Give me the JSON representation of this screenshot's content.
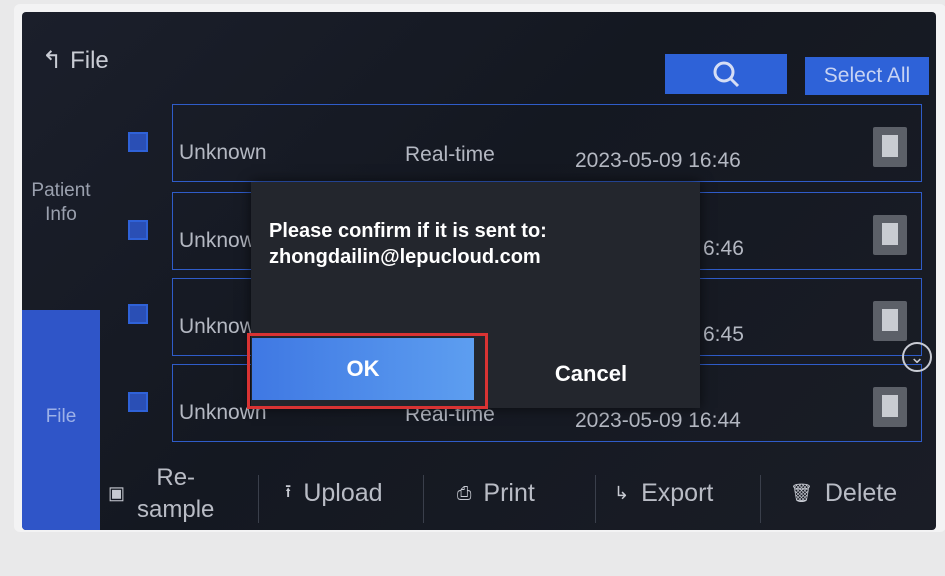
{
  "header": {
    "back_icon": "back-arrow-icon",
    "title": "File",
    "search_icon": "search-icon",
    "select_all": "Select All"
  },
  "sidebar": {
    "items": [
      {
        "label": "Patient\nInfo"
      },
      {
        "label": "File"
      }
    ]
  },
  "records": [
    {
      "name": "Unknown",
      "mode": "Real-time",
      "time": "2023-05-09 16:46"
    },
    {
      "name": "Unknow",
      "mode": "",
      "time": "6:46"
    },
    {
      "name": "Unknow",
      "mode": "",
      "time": "6:45"
    },
    {
      "name": "Unknown",
      "mode": "Real-time",
      "time": "2023-05-09 16:44"
    }
  ],
  "toolbar": {
    "resample": "Re-\nsample",
    "upload": "Upload",
    "print": "Print",
    "export": "Export",
    "delete": "Delete"
  },
  "dialog": {
    "line1": "Please confirm if it is sent to:",
    "line2": "zhongdailin@lepucloud.com",
    "ok": "OK",
    "cancel": "Cancel"
  },
  "colors": {
    "accent": "#2e62d8",
    "highlight": "#d93333"
  }
}
